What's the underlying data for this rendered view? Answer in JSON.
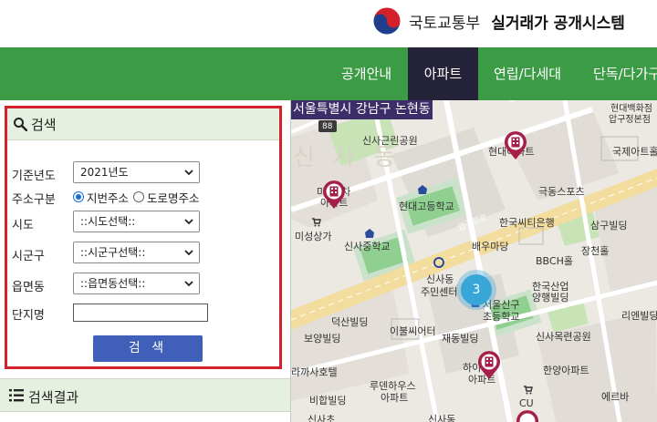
{
  "header": {
    "ministry": "국토교통부",
    "system": "실거래가 공개시스템"
  },
  "nav": {
    "items": [
      "공개안내",
      "아파트",
      "연립/다세대",
      "단독/다가구"
    ],
    "active": "아파트"
  },
  "search": {
    "title": "검색",
    "year_label": "기준년도",
    "year_value": "2021년도",
    "addr_type_label": "주소구분",
    "addr_options": [
      "지번주소",
      "도로명주소"
    ],
    "addr_selected": "지번주소",
    "sido_label": "시도",
    "sido_value": "::시도선택::",
    "sigungu_label": "시군구",
    "sigungu_value": "::시군구선택::",
    "eup_label": "읍면동",
    "eup_value": "::읍면동선택::",
    "complex_label": "단지명",
    "complex_value": "",
    "button": "검 색"
  },
  "results": {
    "title": "검색결과"
  },
  "map": {
    "region_title": "서울특별시 강남구 논현동",
    "cluster_count": "3",
    "labels": {
      "area_sinsa": "신 사 동",
      "road_number": "88",
      "sinsa_park": "신사근린공원",
      "hyundai_apt": "현대아파트",
      "hyundai_dept": "현대백화점",
      "apgujeong_store": "압구정본점",
      "kukje_apt": "국제아트홀",
      "misung_apt_a": "미성1차",
      "misung_apt_b": "아파트",
      "hyundai_high": "현대고등학교",
      "geukdong": "극동스포츠",
      "apgujeong_ro": "압구정로",
      "citibank": "한국씨티은행",
      "samgu": "삼구빌딩",
      "misung_mall": "미성상가",
      "sinsa_middle": "신사중학교",
      "baeumadang": "배우마당",
      "jangcheon": "장천홀",
      "bbch": "BBCH홀",
      "sinsa_center_a": "신사동",
      "sinsa_center_b": "주민센터",
      "kdb_a": "한국산업",
      "kdb_b": "양행빌딩",
      "seoul_sinsa_a": "서울신구",
      "seoul_sinsa_b": "초등학교",
      "rien": "리엔빌딩",
      "deoksan": "덕산빌딩",
      "ibul": "이불씨어터",
      "bo": "보양빌딩",
      "jaedong": "재동빌딩",
      "sinsa_park2": "신사목련공원",
      "rahotel": "라까사호텔",
      "hanyang": "한양아파트",
      "luden_a": "루덴하우스",
      "luden_b": "아파트",
      "hyundai_apt2_a": "하이빌",
      "hyundai_apt2_b": "아파트",
      "erba": "에르바",
      "bihap": "비합빌딩",
      "cu": "CU",
      "sinsa_bottom": "신사초",
      "sinsa_bottom2": "신사동"
    }
  },
  "colors": {
    "nav_green": "#3c9c45",
    "nav_active": "#24233a",
    "search_border": "#d3202a",
    "button_blue": "#3f5fb8",
    "cluster": "#38a6d6",
    "region_title_bg": "#3c2e68"
  }
}
